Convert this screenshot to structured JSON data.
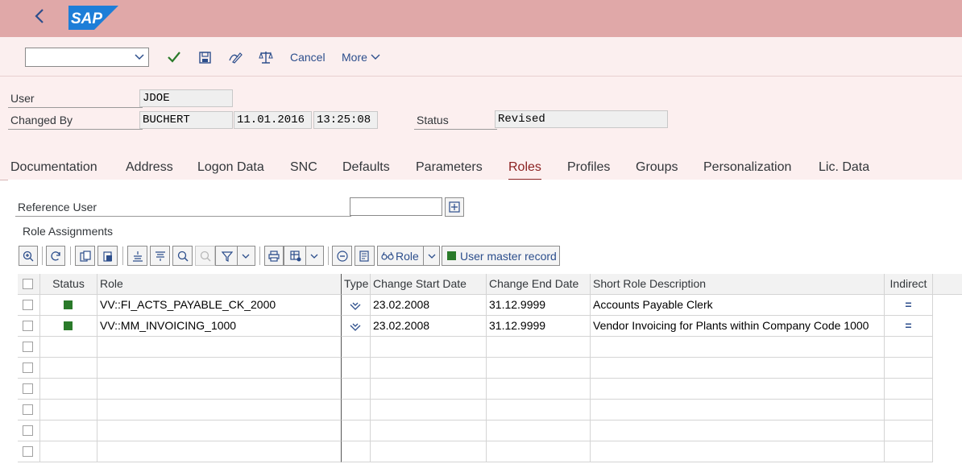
{
  "shell": {
    "logo_text": "SAP"
  },
  "toolbar": {
    "cancel_label": "Cancel",
    "more_label": "More",
    "command_value": ""
  },
  "header": {
    "user_label": "User",
    "user_value": "JDOE",
    "changed_by_label": "Changed By",
    "changed_by_value": "BUCHERT",
    "changed_date": "11.01.2016",
    "changed_time": "13:25:08",
    "status_label": "Status",
    "status_value": "Revised"
  },
  "tabs": [
    "Documentation",
    "Address",
    "Logon Data",
    "SNC",
    "Defaults",
    "Parameters",
    "Roles",
    "Profiles",
    "Groups",
    "Personalization",
    "Lic. Data"
  ],
  "active_tab": "Roles",
  "roles": {
    "reference_user_label": "Reference User",
    "reference_user_value": "",
    "section_title": "Role Assignments",
    "role_button_label": "Role",
    "user_master_record_label": "User master record",
    "columns": [
      "Status",
      "Role",
      "Type",
      "Change Start Date",
      "Change End Date",
      "Short Role Description",
      "Indirect"
    ],
    "rows": [
      {
        "role": "VV::FI_ACTS_PAYABLE_CK_2000",
        "start": "23.02.2008",
        "end": "31.12.9999",
        "desc": "Accounts Payable Clerk",
        "indirect": "="
      },
      {
        "role": "VV::MM_INVOICING_1000",
        "start": "23.02.2008",
        "end": "31.12.9999",
        "desc": "Vendor Invoicing for Plants within Company Code 1000",
        "indirect": "="
      }
    ]
  },
  "colors": {
    "shell": "#e0a8a8",
    "accent": "#8b2121",
    "link": "#2c4e8c",
    "status_green": "#2a7a2a"
  }
}
